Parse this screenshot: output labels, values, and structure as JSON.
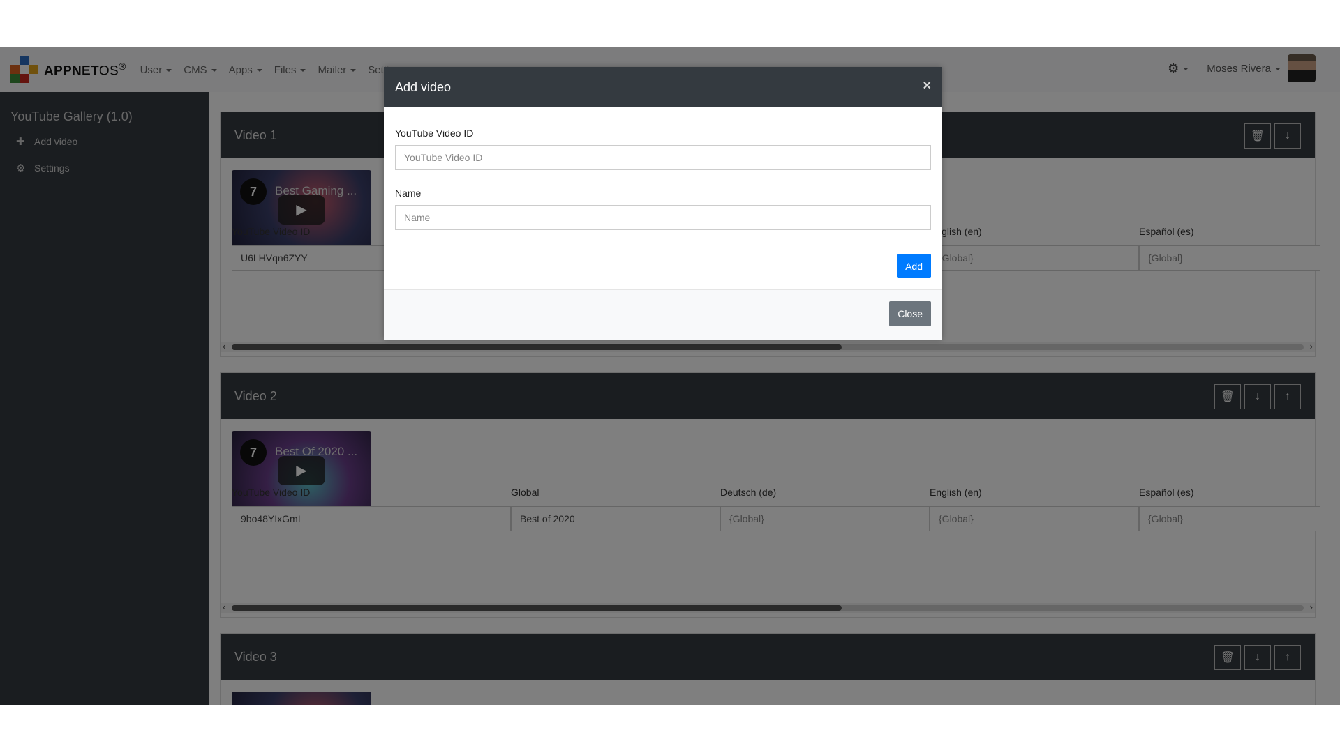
{
  "navbar": {
    "brand_bold": "APPNET",
    "brand_light": "OS",
    "brand_reg": "®",
    "menu": [
      "User",
      "CMS",
      "Apps",
      "Files",
      "Mailer",
      "Settings"
    ],
    "user_name": "Moses Rivera"
  },
  "sidebar": {
    "title": "YouTube Gallery (1.0)",
    "items": [
      {
        "label": "Add video",
        "icon": "plus-icon"
      },
      {
        "label": "Settings",
        "icon": "gear-icon"
      }
    ]
  },
  "columns": [
    "YouTube Video ID",
    "Global",
    "Deutsch (de)",
    "English (en)",
    "Español (es)"
  ],
  "videos": [
    {
      "title": "Video 1",
      "thumb_title": "Best Gaming ...",
      "values": [
        "U6LHVqn6ZYY",
        "",
        "",
        "{Global}",
        "{Global}"
      ]
    },
    {
      "title": "Video 2",
      "thumb_title": "Best Of 2020 ...",
      "values": [
        "9bo48YIxGmI",
        "Best of 2020",
        "{Global}",
        "{Global}",
        "{Global}"
      ]
    },
    {
      "title": "Video 3"
    }
  ],
  "modal": {
    "title": "Add video",
    "id_label": "YouTube Video ID",
    "id_placeholder": "YouTube Video ID",
    "name_label": "Name",
    "name_placeholder": "Name",
    "add_label": "Add",
    "close_label": "Close",
    "close_x": "×"
  },
  "colors": {
    "primary": "#007bff",
    "dark": "#343a40",
    "secondary": "#6c757d"
  }
}
